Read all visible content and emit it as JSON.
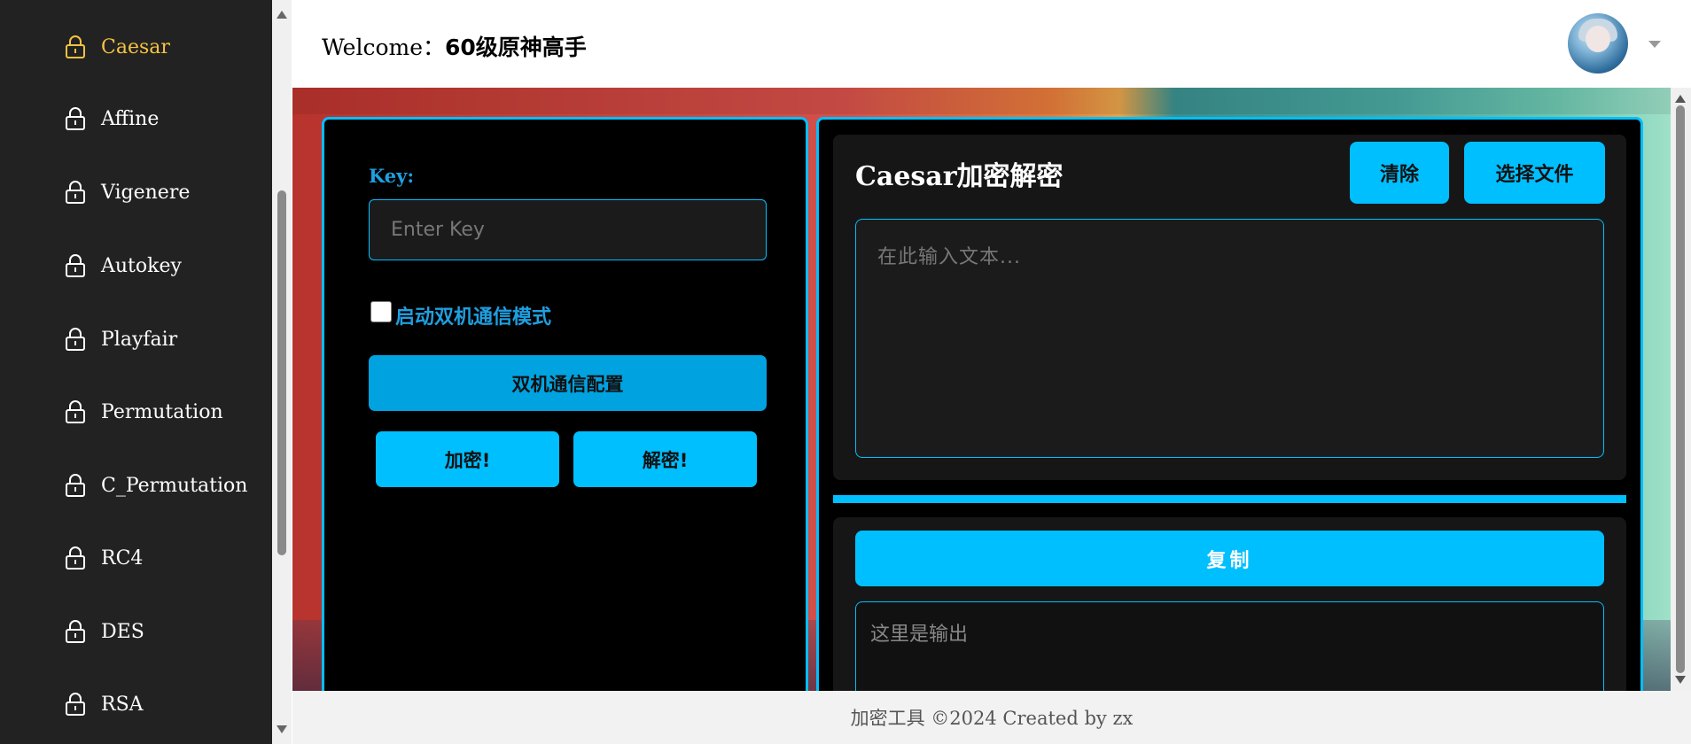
{
  "sidebar": {
    "items": [
      {
        "label": "Caesar",
        "active": true
      },
      {
        "label": "Affine"
      },
      {
        "label": "Vigenere"
      },
      {
        "label": "Autokey"
      },
      {
        "label": "Playfair"
      },
      {
        "label": "Permutation"
      },
      {
        "label": "C_Permutation"
      },
      {
        "label": "RC4"
      },
      {
        "label": "DES"
      },
      {
        "label": "RSA"
      }
    ],
    "icon": "lock-icon",
    "active_color": "#f5c242"
  },
  "header": {
    "welcome_prefix": "Welcome：",
    "username": "60级原神高手"
  },
  "left_panel": {
    "key_label": "Key:",
    "key_placeholder": "Enter Key",
    "dual_mode_label": "启动双机通信模式",
    "config_button": "双机通信配置",
    "encrypt_button": "加密!",
    "decrypt_button": "解密!"
  },
  "right_panel": {
    "title_prefix": "Caesar",
    "title_suffix": "加密解密",
    "clear_button": "清除",
    "file_button": "选择文件",
    "input_placeholder": "在此输入文本...",
    "copy_button": "复制",
    "output_placeholder": "这里是输出"
  },
  "footer": {
    "text": "加密工具 ©2024 Created by zx"
  },
  "colors": {
    "accent": "#00bfff",
    "sidebar_bg": "#222222",
    "panel_bg": "#000000"
  }
}
